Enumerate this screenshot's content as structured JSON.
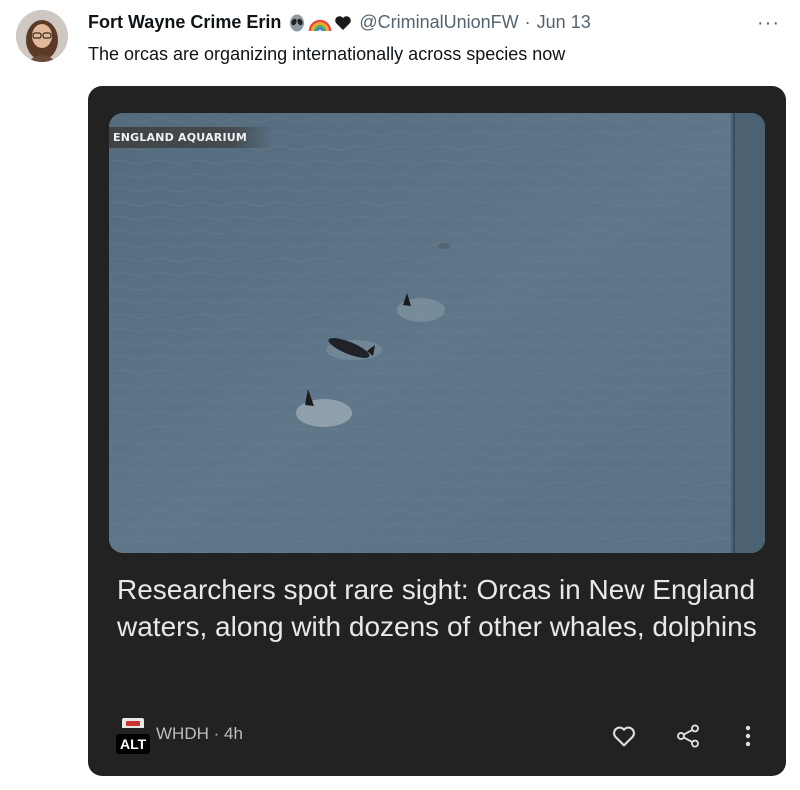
{
  "tweet": {
    "display_name": "Fort Wayne Crime Erin",
    "emojis": [
      "alien-emoji",
      "rainbow-emoji",
      "black-heart-emoji"
    ],
    "handle": "@CriminalUnionFW",
    "separator": "·",
    "date": "Jun 13",
    "more_label": "···",
    "text": "The orcas are organizing internationally across species now"
  },
  "card": {
    "media_watermark": "ENGLAND AQUARIUM",
    "headline": "Researchers spot rare sight: Orcas in New England waters, along with dozens of other whales, dolphins",
    "alt_badge": "ALT",
    "source": "WHDH · 4h",
    "actions": [
      "heart-icon",
      "share-icon",
      "more-vertical-icon"
    ]
  },
  "colors": {
    "card_background": "#222222",
    "water": "#5b7384",
    "headline_text": "#e8e8e8"
  }
}
